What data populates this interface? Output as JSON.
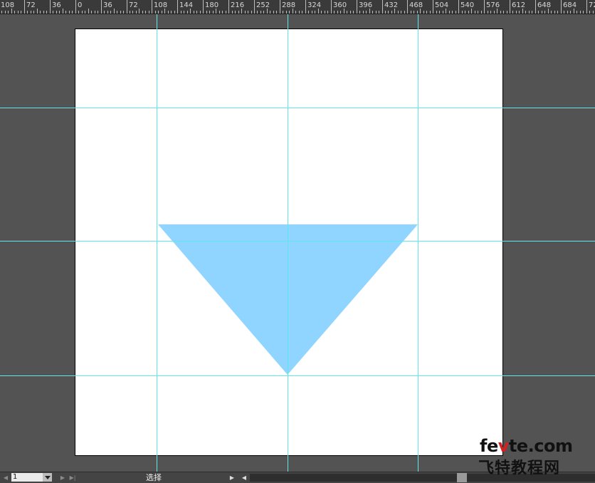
{
  "ruler": {
    "labels": [
      "108",
      "72",
      "36",
      "0",
      "36",
      "72",
      "108",
      "144",
      "180",
      "216",
      "252",
      "288",
      "324",
      "360",
      "396",
      "432",
      "468",
      "504",
      "540",
      "576",
      "612",
      "648",
      "684",
      "72"
    ]
  },
  "shape": {
    "fill": "#8fd5ff",
    "type": "triangle-down"
  },
  "guides": {
    "color": "#5ee8ec"
  },
  "status": {
    "zoom_value": "1",
    "tool_name": "选择"
  },
  "watermark": {
    "site_pre": "fe",
    "site_mid": "v",
    "site_post": "te.com",
    "cn_name": "飞特教程网"
  }
}
